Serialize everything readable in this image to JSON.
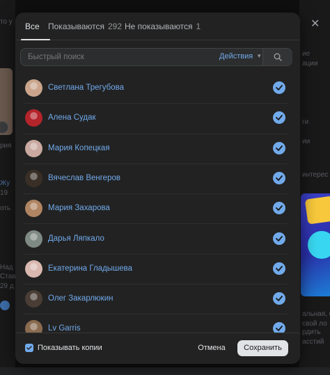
{
  "modal": {
    "tabs": [
      {
        "label": "Все",
        "count": ""
      },
      {
        "label": "Показываются",
        "count": "292"
      },
      {
        "label": "Не показываются",
        "count": "1"
      }
    ],
    "search": {
      "placeholder": "Быстрый поиск"
    },
    "actions_label": "Действия",
    "friends": [
      {
        "name": "Светлана Трегубова",
        "checked": true,
        "avatar_color": "#caa58c"
      },
      {
        "name": "Алена Судак",
        "checked": true,
        "avatar_color": "#b3242b"
      },
      {
        "name": "Мария Копецкая",
        "checked": true,
        "avatar_color": "#c9a9a0"
      },
      {
        "name": "Вячеслав Венгеров",
        "checked": true,
        "avatar_color": "#3a2f26"
      },
      {
        "name": "Мария Захарова",
        "checked": true,
        "avatar_color": "#b08563"
      },
      {
        "name": "Дарья Ляпкало",
        "checked": true,
        "avatar_color": "#7f8a84"
      },
      {
        "name": "Екатерина Гладышева",
        "checked": true,
        "avatar_color": "#d9b8b0"
      },
      {
        "name": "Олег Закарлюкин",
        "checked": true,
        "avatar_color": "#4a3d35"
      },
      {
        "name": "Lv Garris",
        "checked": true,
        "avatar_color": "#8a6b50"
      }
    ],
    "footer": {
      "show_copies_label": "Показывать копии",
      "show_copies_checked": true,
      "cancel_label": "Отмена",
      "save_label": "Сохранить"
    }
  },
  "background": {
    "left_fragments": [
      "то у",
      "рия",
      "Жу",
      "19",
      "оть",
      "Над",
      "Став",
      "29 д"
    ],
    "right_fragments": [
      "ие",
      "ации",
      "ги",
      "ии",
      "интерес",
      "альная, 60",
      "свой ло",
      "рдить",
      "асстий"
    ]
  },
  "colors": {
    "accent": "#71aaeb",
    "modal_bg": "#222222",
    "button_primary_bg": "#e1e3e6"
  }
}
